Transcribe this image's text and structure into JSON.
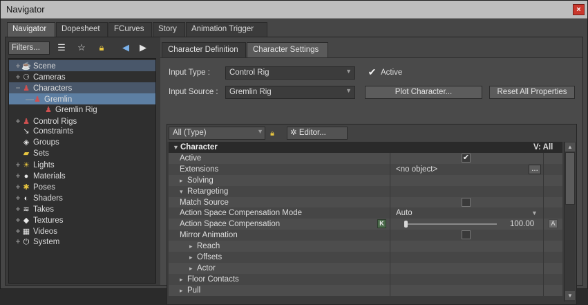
{
  "window": {
    "title": "Navigator",
    "close_label": "×"
  },
  "main_tabs": [
    "Navigator",
    "Dopesheet",
    "FCurves",
    "Story",
    "Animation Trigger"
  ],
  "left": {
    "filters_label": "Filters...",
    "tree": [
      {
        "label": "Scene",
        "icon": "scene-icon",
        "glyph": "☕",
        "exp": "+"
      },
      {
        "label": "Cameras",
        "icon": "camera-icon",
        "glyph": "⚆",
        "exp": "+"
      },
      {
        "label": "Characters",
        "icon": "character-icon",
        "glyph": "♟",
        "exp": "−"
      },
      {
        "label": "Gremlin",
        "icon": "character-icon",
        "glyph": "♟",
        "exp": "—"
      },
      {
        "label": "Gremlin Rig",
        "icon": "rig-icon",
        "glyph": "♟",
        "exp": ""
      },
      {
        "label": "Control Rigs",
        "icon": "control-rig-icon",
        "glyph": "♟",
        "exp": "+"
      },
      {
        "label": "Constraints",
        "icon": "constraint-icon",
        "glyph": "↘",
        "exp": ""
      },
      {
        "label": "Groups",
        "icon": "group-icon",
        "glyph": "◈",
        "exp": ""
      },
      {
        "label": "Sets",
        "icon": "set-icon",
        "glyph": "▰",
        "exp": ""
      },
      {
        "label": "Lights",
        "icon": "light-icon",
        "glyph": "☀",
        "exp": "+"
      },
      {
        "label": "Materials",
        "icon": "material-icon",
        "glyph": "●",
        "exp": "+"
      },
      {
        "label": "Poses",
        "icon": "pose-icon",
        "glyph": "✱",
        "exp": "+"
      },
      {
        "label": "Shaders",
        "icon": "shader-icon",
        "glyph": "◐",
        "exp": "+"
      },
      {
        "label": "Takes",
        "icon": "take-icon",
        "glyph": "≋",
        "exp": "+"
      },
      {
        "label": "Textures",
        "icon": "texture-icon",
        "glyph": "◆",
        "exp": "+"
      },
      {
        "label": "Videos",
        "icon": "video-icon",
        "glyph": "▦",
        "exp": "+"
      },
      {
        "label": "System",
        "icon": "system-icon",
        "glyph": "⏻",
        "exp": "+"
      }
    ]
  },
  "right": {
    "sub_tabs": [
      "Character Definition",
      "Character Settings"
    ],
    "input_type_label": "Input Type :",
    "input_type_value": "Control Rig",
    "active_label": "Active",
    "input_source_label": "Input Source :",
    "input_source_value": "Gremlin Rig",
    "plot_button": "Plot Character...",
    "reset_button": "Reset All Properties",
    "filter_value": "All (Type)",
    "editor_button": "Editor...",
    "properties": [
      {
        "name": "Character",
        "indent": 0,
        "kind": "header",
        "right": "V: All",
        "arrow": "▼"
      },
      {
        "name": "Active",
        "indent": 1,
        "kind": "check",
        "checked": true
      },
      {
        "name": "Extensions",
        "indent": 1,
        "kind": "object",
        "value": "<no object>",
        "btn": "..."
      },
      {
        "name": "Solving",
        "indent": 1,
        "kind": "group",
        "arrow": "▸"
      },
      {
        "name": "Retargeting",
        "indent": 1,
        "kind": "group",
        "arrow": "▾"
      },
      {
        "name": "Match Source",
        "indent": 1,
        "kind": "check",
        "checked": false
      },
      {
        "name": "Action Space Compensation Mode",
        "indent": 1,
        "kind": "combo",
        "value": "Auto"
      },
      {
        "name": "Action Space Compensation",
        "indent": 1,
        "kind": "slider",
        "value": "100.00",
        "fraction": 0.0
      },
      {
        "name": "Mirror Animation",
        "indent": 1,
        "kind": "check",
        "checked": false
      },
      {
        "name": "Reach",
        "indent": 2,
        "kind": "group",
        "arrow": "▸"
      },
      {
        "name": "Offsets",
        "indent": 2,
        "kind": "group",
        "arrow": "▸"
      },
      {
        "name": "Actor",
        "indent": 2,
        "kind": "group",
        "arrow": "▸"
      },
      {
        "name": "Floor Contacts",
        "indent": 1,
        "kind": "group",
        "arrow": "▸"
      },
      {
        "name": "Pull",
        "indent": 1,
        "kind": "group",
        "arrow": "▸"
      }
    ],
    "k_label": "K",
    "a_label": "A"
  }
}
